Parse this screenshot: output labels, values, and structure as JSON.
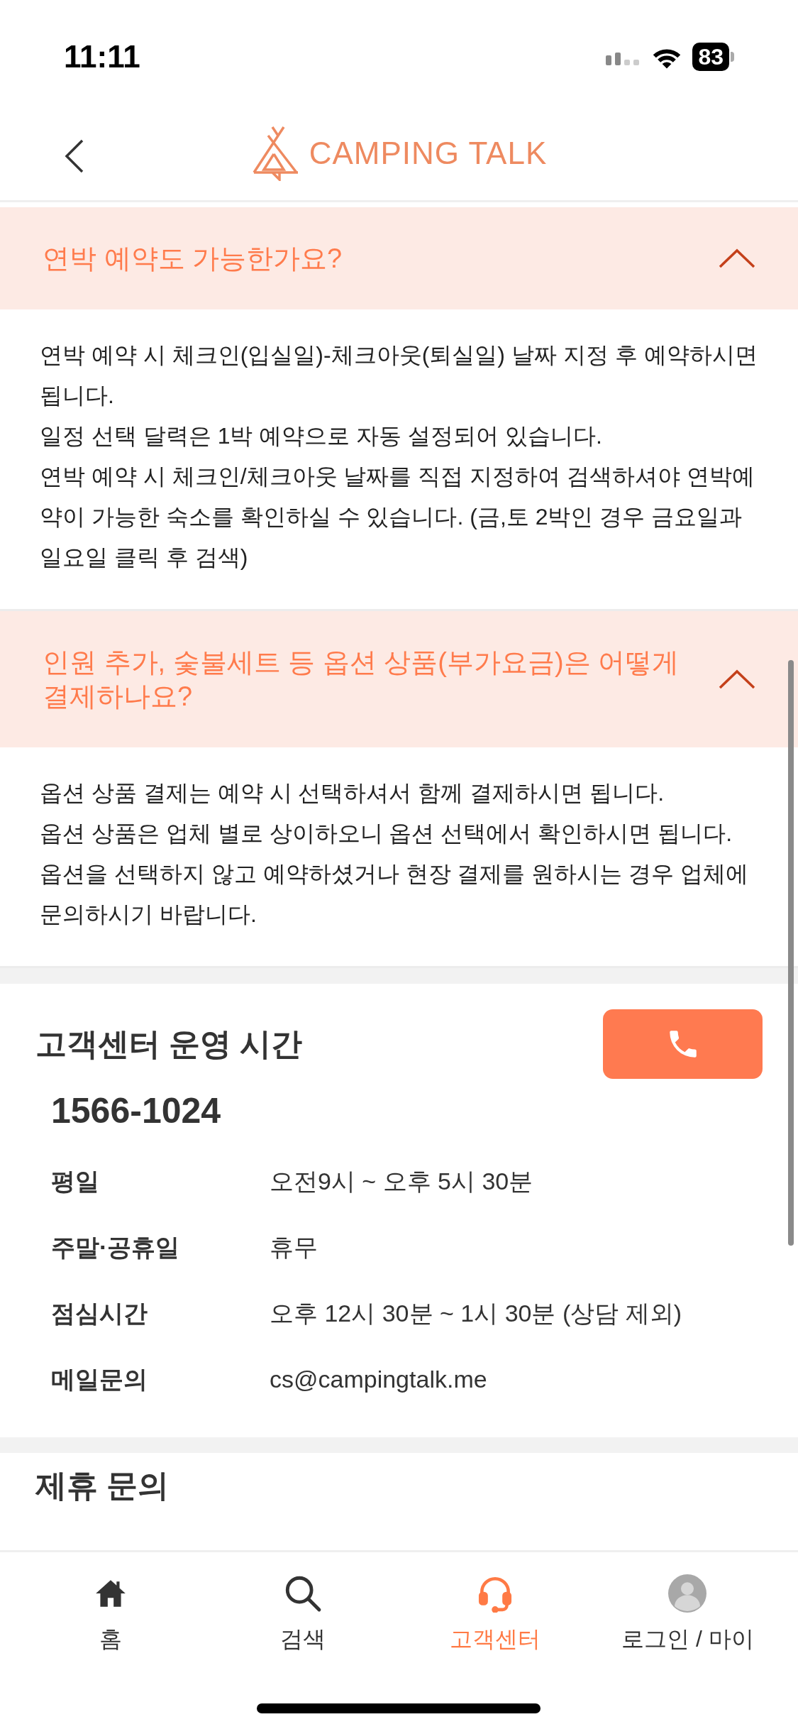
{
  "status_bar": {
    "time": "11:11",
    "battery": "83"
  },
  "header": {
    "logo_text": "CAMPING TALK"
  },
  "faq": [
    {
      "question": "연박 예약도 가능한가요?",
      "expanded": true,
      "answer": [
        "연박 예약 시 체크인(입실일)-체크아웃(퇴실일) 날짜 지정 후 예약하시면 됩니다.",
        "일정 선택 달력은 1박 예약으로 자동 설정되어 있습니다.",
        "연박 예약 시 체크인/체크아웃 날짜를 직접 지정하여 검색하셔야 연박예약이 가능한 숙소를 확인하실 수 있습니다. (금,토 2박인 경우 금요일과 일요일 클릭 후 검색)"
      ]
    },
    {
      "question": "인원 추가, 숯불세트 등 옵션 상품(부가요금)은 어떻게 결제하나요?",
      "expanded": true,
      "answer": [
        "옵션 상품 결제는 예약 시 선택하셔서 함께 결제하시면 됩니다.",
        "옵션 상품은 업체 별로 상이하오니 옵션 선택에서 확인하시면 됩니다.",
        "옵션을 선택하지 않고 예약하셨거나 현장 결제를 원하시는 경우 업체에 문의하시기 바랍니다."
      ]
    }
  ],
  "contact": {
    "title": "고객센터 운영 시간",
    "phone": "1566-1024",
    "rows": [
      {
        "label": "평일",
        "value": "오전9시 ~ 오후 5시 30분"
      },
      {
        "label": "주말·공휴일",
        "value": "휴무"
      },
      {
        "label": "점심시간",
        "value": "오후 12시 30분 ~ 1시 30분 (상담 제외)"
      },
      {
        "label": "메일문의",
        "value": "cs@campingtalk.me"
      }
    ]
  },
  "partnership": {
    "title": "제휴 문의"
  },
  "tabs": [
    {
      "kind": "home",
      "label": "홈",
      "selected": false
    },
    {
      "kind": "search",
      "label": "검색",
      "selected": false
    },
    {
      "kind": "support",
      "label": "고객센터",
      "selected": true
    },
    {
      "kind": "profile",
      "label": "로그인 / 마이",
      "selected": false
    }
  ]
}
